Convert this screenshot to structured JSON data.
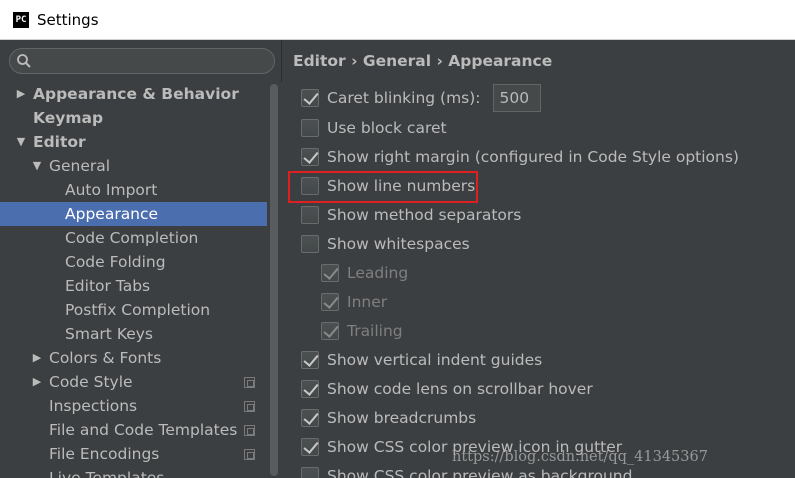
{
  "window": {
    "title": "Settings",
    "app_icon": "PC"
  },
  "search": {
    "placeholder": "",
    "icon": "search-icon"
  },
  "tree": [
    {
      "label": "Appearance & Behavior",
      "expanded": false,
      "bold": true,
      "has_arrow": true
    },
    {
      "label": "Keymap",
      "bold": true,
      "has_arrow": false
    },
    {
      "label": "Editor",
      "expanded": true,
      "bold": true,
      "has_arrow": true
    },
    {
      "label": "General",
      "expanded": true,
      "bold": false,
      "has_arrow": true
    },
    {
      "label": "Auto Import"
    },
    {
      "label": "Appearance",
      "selected": true
    },
    {
      "label": "Code Completion"
    },
    {
      "label": "Code Folding"
    },
    {
      "label": "Editor Tabs"
    },
    {
      "label": "Postfix Completion"
    },
    {
      "label": "Smart Keys"
    },
    {
      "label": "Colors & Fonts",
      "expanded": false,
      "has_arrow": true
    },
    {
      "label": "Code Style",
      "expanded": false,
      "has_arrow": true,
      "project_badge": true
    },
    {
      "label": "Inspections",
      "project_badge": true
    },
    {
      "label": "File and Code Templates",
      "project_badge": true
    },
    {
      "label": "File Encodings",
      "project_badge": true
    },
    {
      "label": "Live Templates"
    }
  ],
  "breadcrumb": {
    "text": "Editor › General › Appearance"
  },
  "options": [
    {
      "label": "Caret blinking (ms):",
      "checked": true,
      "value": "500"
    },
    {
      "label": "Use block caret",
      "checked": false
    },
    {
      "label": "Show right margin (configured in Code Style options)",
      "checked": true
    },
    {
      "label": "Show line numbers",
      "checked": false,
      "highlighted": true
    },
    {
      "label": "Show method separators",
      "checked": false
    },
    {
      "label": "Show whitespaces",
      "checked": false
    },
    {
      "label": "Leading",
      "checked": true,
      "disabled": true
    },
    {
      "label": "Inner",
      "checked": true,
      "disabled": true
    },
    {
      "label": "Trailing",
      "checked": true,
      "disabled": true
    },
    {
      "label": "Show vertical indent guides",
      "checked": true
    },
    {
      "label": "Show code lens on scrollbar hover",
      "checked": true
    },
    {
      "label": "Show breadcrumbs",
      "checked": true
    },
    {
      "label": "Show CSS color preview icon in gutter",
      "checked": true
    },
    {
      "label": "Show CSS color preview as background",
      "checked": false
    }
  ],
  "watermark": "https://blog.csdn.net/qq_41345367",
  "colors": {
    "selection": "#4b6eaf",
    "background": "#3c3f41",
    "highlight": "#e02020"
  }
}
